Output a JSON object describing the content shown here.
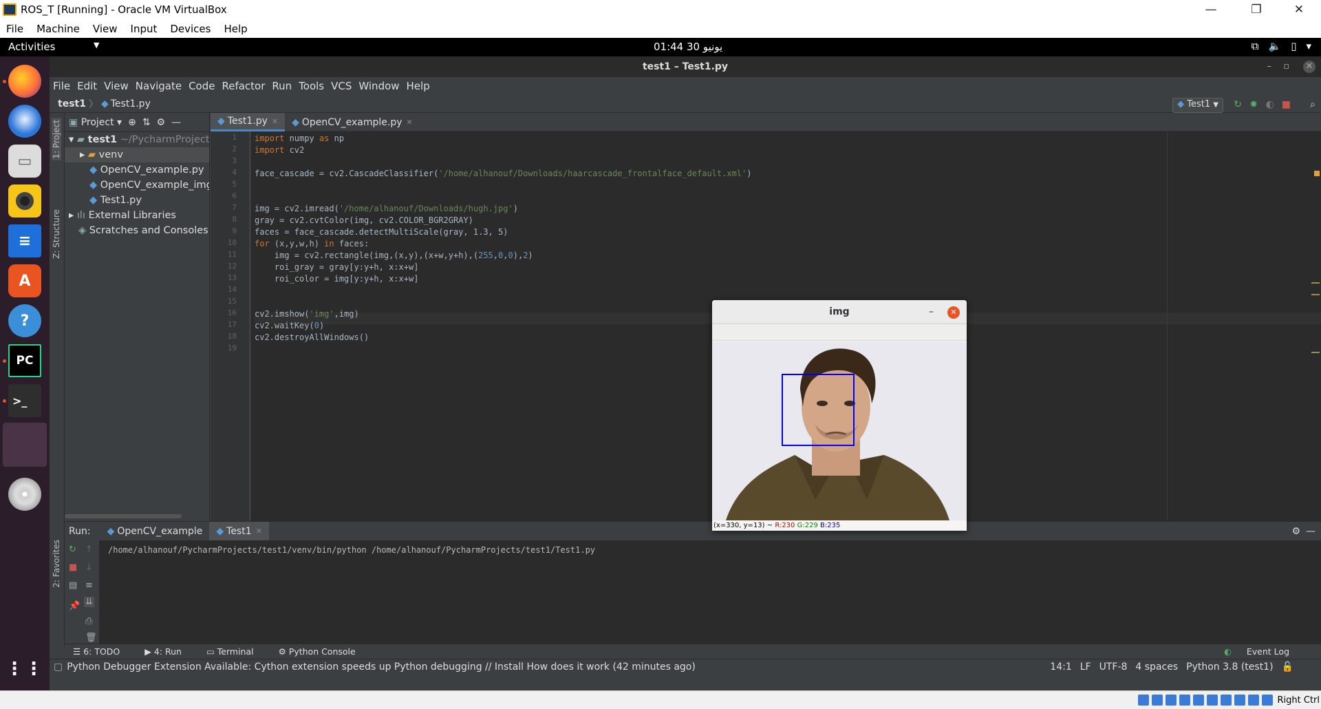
{
  "vbox": {
    "title": "ROS_T [Running] - Oracle VM VirtualBox",
    "menu": [
      "File",
      "Machine",
      "View",
      "Input",
      "Devices",
      "Help"
    ],
    "host_key": "Right Ctrl"
  },
  "gnome": {
    "activities": "Activities",
    "clock": "01:44  30 يونيو"
  },
  "dock": {
    "items": [
      "firefox",
      "thunderbird",
      "files",
      "rhythmbox",
      "libreoffice-writer",
      "ubuntu-software",
      "help",
      "pycharm",
      "terminal",
      "unknown-app",
      "dvd"
    ]
  },
  "pycharm": {
    "window_title": "test1 – Test1.py",
    "menu": [
      "File",
      "Edit",
      "View",
      "Navigate",
      "Code",
      "Refactor",
      "Run",
      "Tools",
      "VCS",
      "Window",
      "Help"
    ],
    "breadcrumb": [
      "test1",
      "Test1.py"
    ],
    "run_config": "Test1",
    "left_tabs": [
      "1: Project",
      "Z: Structure",
      "2: Favorites"
    ],
    "project": {
      "header": "Project",
      "tree": [
        {
          "label": "test1",
          "extra": "~/PycharmProjects",
          "type": "project"
        },
        {
          "label": "venv",
          "type": "folder"
        },
        {
          "label": "OpenCV_example.py",
          "type": "file"
        },
        {
          "label": "OpenCV_example_img",
          "type": "file"
        },
        {
          "label": "Test1.py",
          "type": "file"
        },
        {
          "label": "External Libraries",
          "type": "lib"
        },
        {
          "label": "Scratches and Consoles",
          "type": "scratch"
        }
      ]
    },
    "editor_tabs": [
      {
        "label": "Test1.py",
        "active": true
      },
      {
        "label": "OpenCV_example.py",
        "active": false
      }
    ],
    "line_numbers": [
      "1",
      "2",
      "3",
      "4",
      "5",
      "6",
      "7",
      "8",
      "9",
      "10",
      "11",
      "12",
      "13",
      "14",
      "15",
      "16",
      "17",
      "18",
      "19"
    ],
    "current_line": 14,
    "code": [
      "import numpy as np",
      "import cv2",
      "",
      "face_cascade = cv2.CascadeClassifier('/home/alhanouf/Downloads/haarcascade_frontalface_default.xml')",
      "",
      "",
      "img = cv2.imread('/home/alhanouf/Downloads/hugh.jpg')",
      "gray = cv2.cvtColor(img, cv2.COLOR_BGR2GRAY)",
      "faces = face_cascade.detectMultiScale(gray, 1.3, 5)",
      "for (x,y,w,h) in faces:",
      "    img = cv2.rectangle(img,(x,y),(x+w,y+h),(255,0,0),2)",
      "    roi_gray = gray[y:y+h, x:x+w]",
      "    roi_color = img[y:y+h, x:x+w]",
      "",
      "",
      "cv2.imshow('img',img)",
      "cv2.waitKey(0)",
      "cv2.destroyAllWindows()",
      ""
    ],
    "run": {
      "label": "Run:",
      "tabs": [
        {
          "label": "OpenCV_example",
          "active": false
        },
        {
          "label": "Test1",
          "active": true
        }
      ],
      "output": "/home/alhanouf/PycharmProjects/test1/venv/bin/python /home/alhanouf/PycharmProjects/test1/Test1.py"
    },
    "bottom_tabs": [
      "6: TODO",
      "4: Run",
      "Terminal",
      "Python Console"
    ],
    "event_log": "Event Log",
    "status": {
      "message": "Python Debugger Extension Available: Cython extension speeds up Python debugging // Install  How does it work (42 minutes ago)",
      "position": "14:1",
      "line_sep": "LF",
      "encoding": "UTF-8",
      "indent": "4 spaces",
      "interpreter": "Python 3.8 (test1)"
    }
  },
  "img_window": {
    "title": "img",
    "status": {
      "coords": "(x=330, y=13) ~ ",
      "r": "R:230",
      "g": "G:229",
      "b": "B:235"
    }
  }
}
